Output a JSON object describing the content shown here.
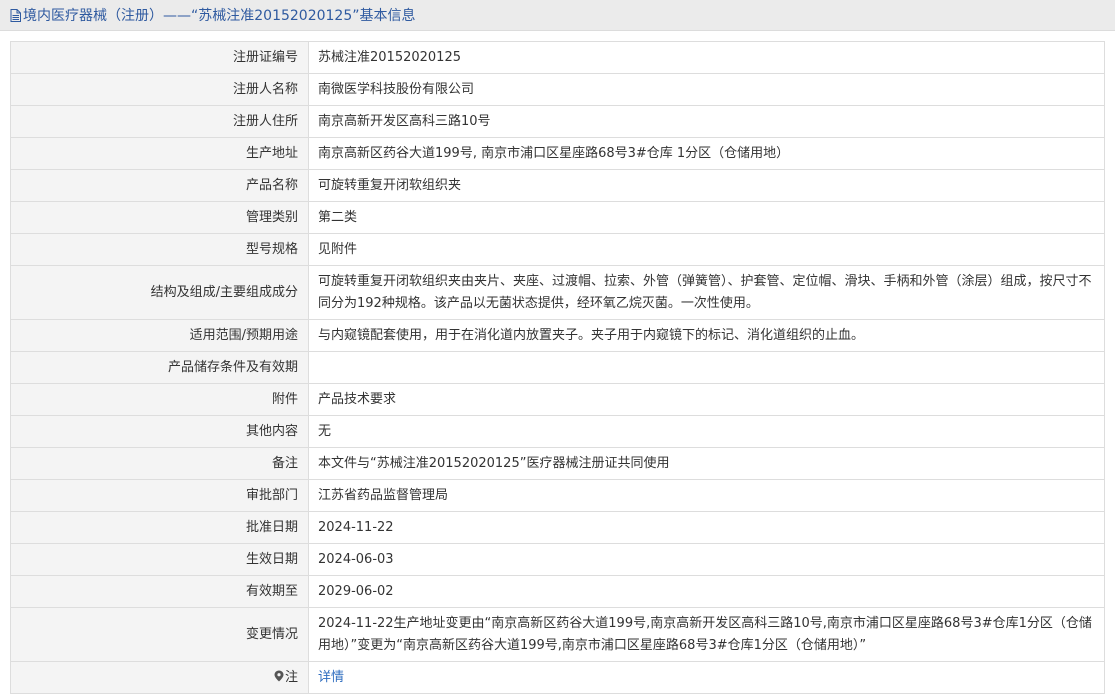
{
  "header": {
    "title": "境内医疗器械（注册）——“苏械注准20152020125”基本信息"
  },
  "rows": [
    {
      "label": "注册证编号",
      "value": "苏械注准20152020125"
    },
    {
      "label": "注册人名称",
      "value": "南微医学科技股份有限公司"
    },
    {
      "label": "注册人住所",
      "value": "南京高新开发区高科三路10号"
    },
    {
      "label": "生产地址",
      "value": "南京高新区药谷大道199号, 南京市浦口区星座路68号3#仓库 1分区（仓储用地）"
    },
    {
      "label": "产品名称",
      "value": "可旋转重复开闭软组织夹"
    },
    {
      "label": "管理类别",
      "value": "第二类"
    },
    {
      "label": "型号规格",
      "value": "见附件"
    },
    {
      "label": "结构及组成/主要组成成分",
      "value": "可旋转重复开闭软组织夹由夹片、夹座、过渡帽、拉索、外管（弹簧管）、护套管、定位帽、滑块、手柄和外管（涂层）组成，按尺寸不同分为192种规格。该产品以无菌状态提供，经环氧乙烷灭菌。一次性使用。"
    },
    {
      "label": "适用范围/预期用途",
      "value": "与内窥镜配套使用，用于在消化道内放置夹子。夹子用于内窥镜下的标记、消化道组织的止血。"
    },
    {
      "label": "产品储存条件及有效期",
      "value": ""
    },
    {
      "label": "附件",
      "value": "产品技术要求"
    },
    {
      "label": "其他内容",
      "value": "无"
    },
    {
      "label": "备注",
      "value": "本文件与“苏械注准20152020125”医疗器械注册证共同使用"
    },
    {
      "label": "审批部门",
      "value": "江苏省药品监督管理局"
    },
    {
      "label": "批准日期",
      "value": "2024-11-22"
    },
    {
      "label": "生效日期",
      "value": "2024-06-03"
    },
    {
      "label": "有效期至",
      "value": "2029-06-02"
    },
    {
      "label": "变更情况",
      "value": "2024-11-22生产地址变更由“南京高新区药谷大道199号,南京高新开发区高科三路10号,南京市浦口区星座路68号3#仓库1分区（仓储用地）”变更为“南京高新区药谷大道199号,南京市浦口区星座路68号3#仓库1分区（仓储用地）”"
    }
  ],
  "note_row": {
    "label": "注",
    "link_text": "详情"
  },
  "colors": {
    "title": "#2f5aa0",
    "link": "#2f6dbf",
    "label_bg": "#f4f4f4",
    "border": "#dddddd"
  }
}
